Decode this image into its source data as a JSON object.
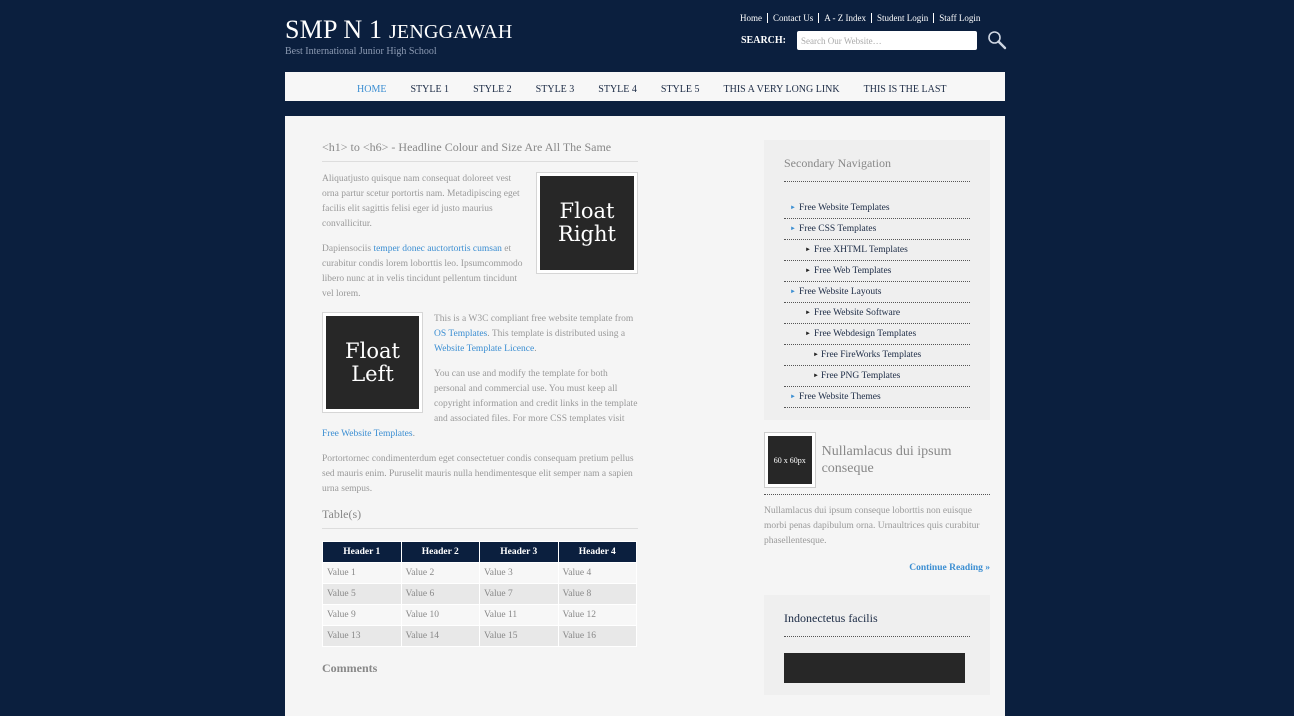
{
  "header": {
    "title_main": "SMP N 1 ",
    "title_sc": "Jenggawah",
    "subtitle": "Best International Junior High School",
    "top_links": [
      "Home",
      "Contact Us",
      "A - Z Index",
      "Student Login",
      "Staff Login"
    ],
    "search_label": "SEARCH:",
    "search_placeholder": "Search Our Website…",
    "search_icon": "search-icon"
  },
  "nav": {
    "items": [
      "Home",
      "Style 1",
      "Style 2",
      "Style 3",
      "Style 4",
      "Style 5",
      "This A Very Long Link",
      "This Is The Last"
    ],
    "active": "Home",
    "active_color": "#3b8ed2"
  },
  "content": {
    "heading": "<h1> to <h6> - Headline Colour and Size Are All The Same",
    "float_right_text": "Float Right",
    "float_left_text": "Float Left",
    "p1": "Aliquatjusto quisque nam consequat doloreet vest orna partur scetur portortis nam. Metadipiscing eget facilis elit sagittis felisi eger id justo maurius convallicitur.",
    "p2_pre": "Dapiensociis ",
    "p2_link": "temper donec auctortortis cumsan",
    "p2_post": " et curabitur condis lorem loborttis leo. Ipsumcommodo libero nunc at in velis tincidunt pellentum tincidunt vel lorem.",
    "p3_pre": "This is a W3C compliant free website template from ",
    "p3_link1": "OS Templates",
    "p3_mid": ". This template is distributed using a ",
    "p3_link2": "Website Template Licence",
    "p3_post": ".",
    "p4_pre": "You can use and modify the template for both personal and commercial use. You must keep all copyright information and credit links in the template and associated files. For more CSS templates visit ",
    "p4_link": "Free Website Templates",
    "p4_post": ".",
    "p5": "Portortornec condimenterdum eget consectetuer condis consequam pretium pellus sed mauris enim. Puruselit mauris nulla hendimentesque elit semper nam a sapien urna sempus.",
    "table_heading": "Table(s)",
    "table": {
      "headers": [
        "Header 1",
        "Header 2",
        "Header 3",
        "Header 4"
      ],
      "rows": [
        [
          "Value 1",
          "Value 2",
          "Value 3",
          "Value 4"
        ],
        [
          "Value 5",
          "Value 6",
          "Value 7",
          "Value 8"
        ],
        [
          "Value 9",
          "Value 10",
          "Value 11",
          "Value 12"
        ],
        [
          "Value 13",
          "Value 14",
          "Value 15",
          "Value 16"
        ]
      ]
    },
    "comments_heading": "Comments"
  },
  "sidebar": {
    "secondary_nav_title": "Secondary Navigation",
    "secondary_nav": [
      {
        "label": "Free Website Templates",
        "level": 1
      },
      {
        "label": "Free CSS Templates",
        "level": 1
      },
      {
        "label": "Free XHTML Templates",
        "level": 2
      },
      {
        "label": "Free Web Templates",
        "level": 2
      },
      {
        "label": "Free Website Layouts",
        "level": 1
      },
      {
        "label": "Free Website Software",
        "level": 2
      },
      {
        "label": "Free Webdesign Templates",
        "level": 2
      },
      {
        "label": "Free FireWorks Templates",
        "level": 3
      },
      {
        "label": "Free PNG Templates",
        "level": 3
      },
      {
        "label": "Free Website Themes",
        "level": 1
      }
    ],
    "featured": {
      "thumb_text": "60 x 60px",
      "title": "Nullamlacus dui ipsum conseque",
      "text": "Nullamlacus dui ipsum conseque loborttis non euisque morbi penas dapibulum orna. Urnaultrices quis curabitur phasellentesque.",
      "more": "Continue Reading »"
    },
    "box3_title": "Indonectetus facilis"
  }
}
